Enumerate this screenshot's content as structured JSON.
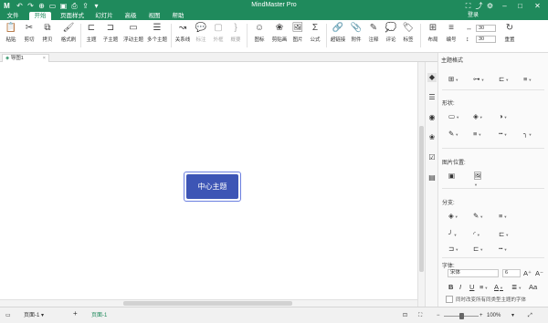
{
  "titlebar": {
    "app_title": "MindMaster Pro",
    "quick_icons": [
      "logo-icon",
      "undo-icon",
      "redo-icon",
      "new-icon",
      "open-icon",
      "save-icon",
      "print-icon",
      "export-icon",
      "more-icon"
    ],
    "right_icons": [
      "fullscreen-icon",
      "share-icon",
      "settings-icon",
      "minimize-icon",
      "maximize-icon",
      "close-icon"
    ]
  },
  "menu": {
    "tabs": [
      "文件",
      "开始",
      "页面样式",
      "幻灯片",
      "高级",
      "视图",
      "帮助"
    ],
    "active": "开始",
    "login": "登录"
  },
  "ribbon": {
    "items": [
      {
        "label": "粘贴",
        "icon": "paste-icon",
        "glyph": "📋"
      },
      {
        "label": "剪切",
        "icon": "cut-icon",
        "glyph": "✂"
      },
      {
        "label": "拷贝",
        "icon": "copy-icon",
        "glyph": "⧉"
      },
      {
        "label": "格式刷",
        "icon": "format-brush-icon",
        "glyph": "🖌"
      },
      {
        "label": "主题",
        "icon": "topic-icon",
        "glyph": "⊏"
      },
      {
        "label": "子主题",
        "icon": "subtopic-icon",
        "glyph": "⊐"
      },
      {
        "label": "浮动主题",
        "icon": "floating-topic-icon",
        "glyph": "▭"
      },
      {
        "label": "多个主题",
        "icon": "multiple-topics-icon",
        "glyph": "☰"
      },
      {
        "label": "关系线",
        "icon": "relationship-icon",
        "glyph": "↝"
      },
      {
        "label": "标注",
        "icon": "callout-icon",
        "glyph": "💬",
        "disabled": true
      },
      {
        "label": "外框",
        "icon": "boundary-icon",
        "glyph": "▢",
        "disabled": true
      },
      {
        "label": "概要",
        "icon": "summary-icon",
        "glyph": "}",
        "disabled": true
      },
      {
        "label": "图标",
        "icon": "icon-picker-icon",
        "glyph": "☺"
      },
      {
        "label": "剪贴画",
        "icon": "clipart-icon",
        "glyph": "❀"
      },
      {
        "label": "图片",
        "icon": "image-icon",
        "glyph": "🖼"
      },
      {
        "label": "公式",
        "icon": "formula-icon",
        "glyph": "Σ"
      },
      {
        "label": "超链接",
        "icon": "hyperlink-icon",
        "glyph": "🔗"
      },
      {
        "label": "附件",
        "icon": "attachment-icon",
        "glyph": "📎"
      },
      {
        "label": "注释",
        "icon": "note-icon",
        "glyph": "✎"
      },
      {
        "label": "评论",
        "icon": "comment-icon",
        "glyph": "💭"
      },
      {
        "label": "标签",
        "icon": "tag-icon",
        "glyph": "🏷"
      },
      {
        "label": "布局",
        "icon": "layout-icon",
        "glyph": "⊞"
      },
      {
        "label": "编号",
        "icon": "numbering-icon",
        "glyph": "≡"
      },
      {
        "label": "重置",
        "icon": "reset-icon",
        "glyph": "↻"
      }
    ],
    "spin_a": "30",
    "spin_b": "30"
  },
  "doc_tab": {
    "label": "导图1"
  },
  "canvas": {
    "central_topic": "中心主题"
  },
  "panel": {
    "title": "主题格式",
    "shape_label": "形状:",
    "image_pos_label": "图片位置:",
    "branch_label": "分支:",
    "font_label": "字体:",
    "font_name": "宋体",
    "font_size": "6",
    "apply_all": "同时改变所有同类型主题的字体"
  },
  "status": {
    "page_a": "页面-1",
    "add": "+",
    "page_b": "页面-1",
    "zoom": "100%"
  }
}
